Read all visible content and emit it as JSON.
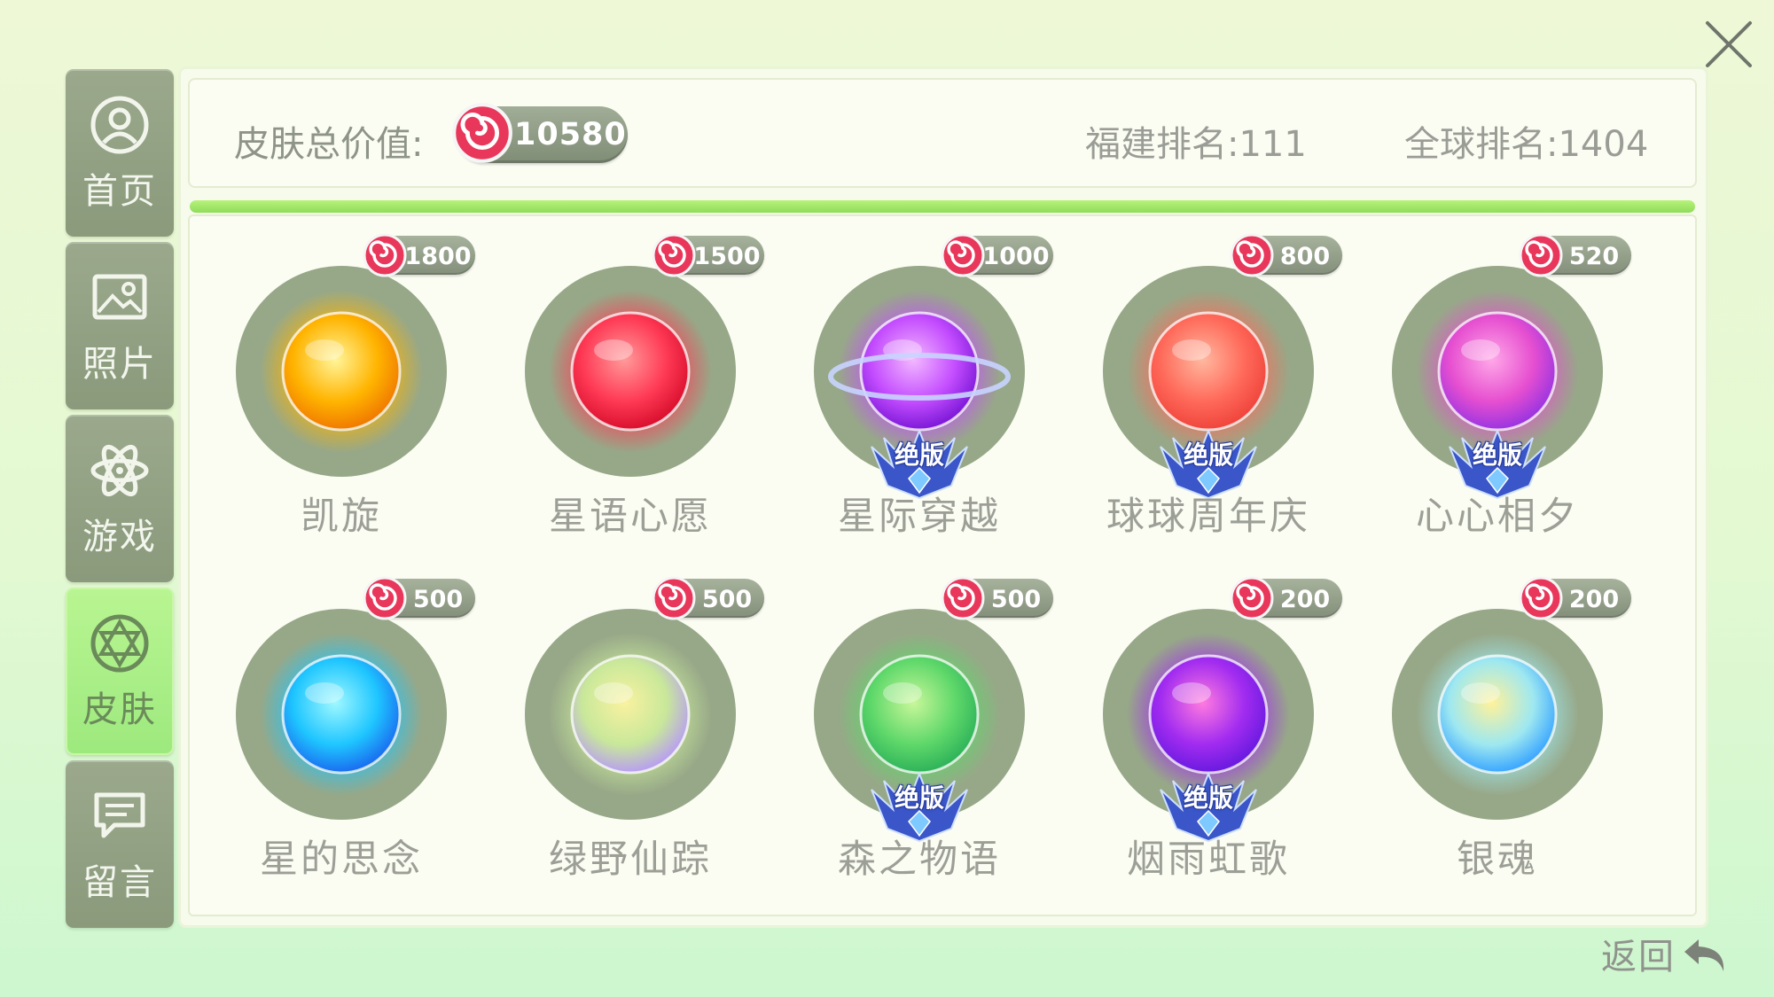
{
  "header": {
    "total_label": "皮肤总价值:",
    "total_value": "10580",
    "province_rank": "福建排名:111",
    "global_rank": "全球排名:1404"
  },
  "sidebar": {
    "items": [
      {
        "label": "首页",
        "icon": "user-icon",
        "active": false
      },
      {
        "label": "照片",
        "icon": "image-icon",
        "active": false
      },
      {
        "label": "游戏",
        "icon": "atom-icon",
        "active": false
      },
      {
        "label": "皮肤",
        "icon": "skin-icon",
        "active": true
      },
      {
        "label": "留言",
        "icon": "message-icon",
        "active": false
      }
    ]
  },
  "skins": [
    {
      "name": "凯旋",
      "price": "1800",
      "badge": ""
    },
    {
      "name": "星语心愿",
      "price": "1500",
      "badge": ""
    },
    {
      "name": "星际穿越",
      "price": "1000",
      "badge": "绝版"
    },
    {
      "name": "球球周年庆",
      "price": "800",
      "badge": "绝版"
    },
    {
      "name": "心心相夕",
      "price": "520",
      "badge": "绝版"
    },
    {
      "name": "星的思念",
      "price": "500",
      "badge": ""
    },
    {
      "name": "绿野仙踪",
      "price": "500",
      "badge": ""
    },
    {
      "name": "森之物语",
      "price": "500",
      "badge": "绝版"
    },
    {
      "name": "烟雨虹歌",
      "price": "200",
      "badge": "绝版"
    },
    {
      "name": "银魂",
      "price": "200",
      "badge": ""
    }
  ],
  "back_label": "返回",
  "colors": {
    "accent_green": "#9de97e",
    "tab_gray": "#8a9a7b",
    "badge_blue": "#3a56c9",
    "candy_red": "#e8375a"
  },
  "progress": 1.0
}
